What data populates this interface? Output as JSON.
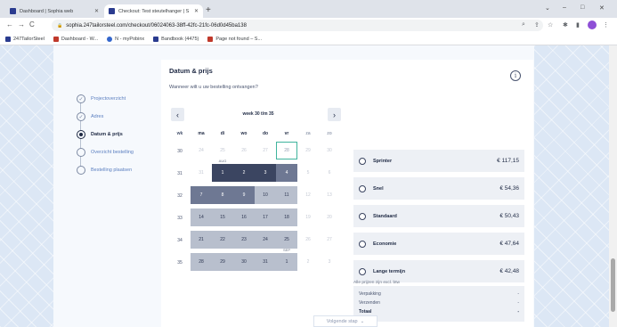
{
  "browser": {
    "tabs": [
      {
        "title": "Dashboard | Sophia web",
        "active": false
      },
      {
        "title": "Checkout: Test steutelhanger | S",
        "active": true
      }
    ],
    "new_tab": "+",
    "window_controls": {
      "minimize": "‒",
      "maximize": "□",
      "close": "✕",
      "tabs_menu": "⌄"
    },
    "nav": {
      "back": "←",
      "forward": "→",
      "reload": "C"
    },
    "url": "sophia.247tailorsteel.com/checkout/06024063-38ff-42fc-21fc-06d0d45ba138",
    "toolbar_icons": [
      "search-icon",
      "share-icon",
      "star-icon",
      "extensions-icon",
      "sidebar-icon",
      "profile-icon",
      "menu-icon"
    ],
    "toolbar_glyphs": {
      "search": "⌕",
      "share": "⇪",
      "star": "☆",
      "ext": "✱",
      "sidebar": "▮",
      "menu": "⋮"
    },
    "bookmarks": [
      {
        "label": "247TailorSteel",
        "color": "#2a3b8f"
      },
      {
        "label": "Dashboard - W...",
        "color": "#c0392b"
      },
      {
        "label": "N - myPobinx",
        "color": "#3366cc"
      },
      {
        "label": "Bandbook (4475)",
        "color": "#2a3b8f"
      },
      {
        "label": "Page not found – S...",
        "color": "#c0392b"
      }
    ]
  },
  "stepper": {
    "steps": [
      {
        "label": "Projectoverzicht",
        "state": "done",
        "glyph": "✓"
      },
      {
        "label": "Adres",
        "state": "done",
        "glyph": "✓"
      },
      {
        "label": "Datum & prijs",
        "state": "active",
        "glyph": ""
      },
      {
        "label": "Overzicht bestelling",
        "state": "todo",
        "glyph": ""
      },
      {
        "label": "Bestelling plaatsen",
        "state": "todo",
        "glyph": ""
      }
    ]
  },
  "main": {
    "title": "Datum & prijs",
    "subtitle": "Wanneer wilt u uw bestelling ontvangen?",
    "info_glyph": "i",
    "calendar": {
      "prev": "‹",
      "next": "›",
      "week_label": "week 30 t/m 35",
      "headers": [
        "wk",
        "ma",
        "di",
        "wo",
        "do",
        "vr",
        "za",
        "zo"
      ],
      "rows": [
        {
          "week": "30",
          "days": [
            {
              "d": "24",
              "s": "muted"
            },
            {
              "d": "25",
              "s": "muted"
            },
            {
              "d": "26",
              "s": "muted"
            },
            {
              "d": "27",
              "s": "muted"
            },
            {
              "d": "28",
              "s": "today"
            },
            {
              "d": "29",
              "s": "muted"
            },
            {
              "d": "30",
              "s": "muted"
            }
          ]
        },
        {
          "week": "31",
          "days": [
            {
              "d": "31",
              "s": "muted"
            },
            {
              "d": "1",
              "s": "dark",
              "m": "AUG"
            },
            {
              "d": "2",
              "s": "dark"
            },
            {
              "d": "3",
              "s": "dark"
            },
            {
              "d": "4",
              "s": "mid"
            },
            {
              "d": "5",
              "s": "muted"
            },
            {
              "d": "6",
              "s": "muted"
            }
          ]
        },
        {
          "week": "32",
          "days": [
            {
              "d": "7",
              "s": "mid"
            },
            {
              "d": "8",
              "s": "mid"
            },
            {
              "d": "9",
              "s": "mid"
            },
            {
              "d": "10",
              "s": "light"
            },
            {
              "d": "11",
              "s": "light"
            },
            {
              "d": "12",
              "s": "muted"
            },
            {
              "d": "13",
              "s": "muted"
            }
          ]
        },
        {
          "week": "33",
          "days": [
            {
              "d": "14",
              "s": "light"
            },
            {
              "d": "15",
              "s": "light"
            },
            {
              "d": "16",
              "s": "light"
            },
            {
              "d": "17",
              "s": "light"
            },
            {
              "d": "18",
              "s": "light"
            },
            {
              "d": "19",
              "s": "muted"
            },
            {
              "d": "20",
              "s": "muted"
            }
          ]
        },
        {
          "week": "34",
          "days": [
            {
              "d": "21",
              "s": "light"
            },
            {
              "d": "22",
              "s": "light"
            },
            {
              "d": "23",
              "s": "light"
            },
            {
              "d": "24",
              "s": "light"
            },
            {
              "d": "25",
              "s": "light"
            },
            {
              "d": "26",
              "s": "muted"
            },
            {
              "d": "27",
              "s": "muted"
            }
          ]
        },
        {
          "week": "35",
          "days": [
            {
              "d": "28",
              "s": "light"
            },
            {
              "d": "29",
              "s": "light"
            },
            {
              "d": "30",
              "s": "light"
            },
            {
              "d": "31",
              "s": "light"
            },
            {
              "d": "1",
              "s": "light",
              "m": "SEP"
            },
            {
              "d": "2",
              "s": "muted"
            },
            {
              "d": "3",
              "s": "muted"
            }
          ]
        }
      ]
    },
    "shipping_options": [
      {
        "name": "Sprinter",
        "price": "€ 117,15"
      },
      {
        "name": "Snel",
        "price": "€ 54,36"
      },
      {
        "name": "Standaard",
        "price": "€ 50,43"
      },
      {
        "name": "Economie",
        "price": "€ 47,64"
      },
      {
        "name": "Lange termijn",
        "price": "€ 42,48"
      }
    ],
    "summary": {
      "rows": [
        {
          "label": "Verpakking",
          "value": "-"
        },
        {
          "label": "Verzenden",
          "value": "-"
        },
        {
          "label": "Totaal",
          "value": "-"
        }
      ]
    },
    "vat_note": "Alle prijzen zijn excl. btw",
    "next_button": {
      "label": "Volgende stap",
      "glyph": "⌄"
    }
  },
  "colors": {
    "accent_dark": "#3b4561",
    "today_border": "#3fb49d",
    "profile": "#8e4fd6"
  }
}
